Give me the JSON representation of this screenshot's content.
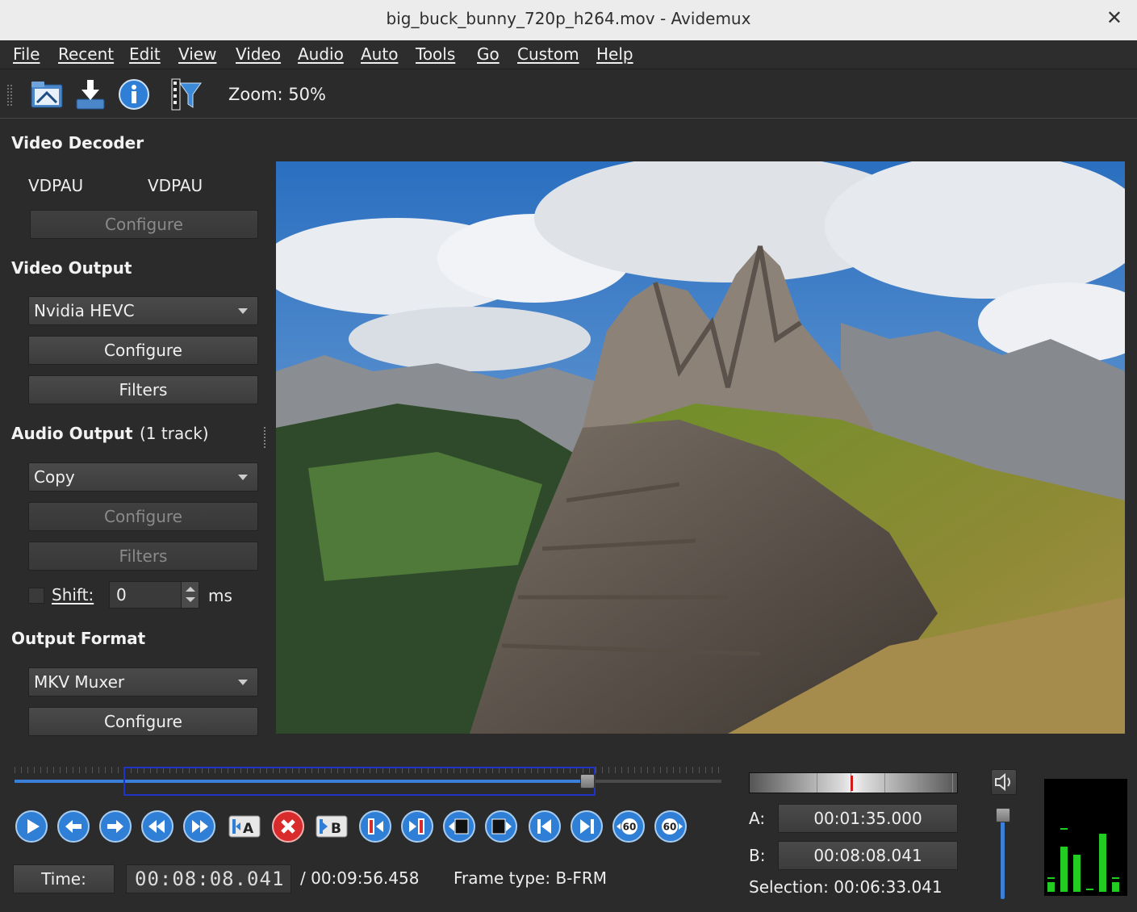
{
  "window": {
    "title": "big_buck_bunny_720p_h264.mov - Avidemux"
  },
  "menu": [
    "File",
    "Recent",
    "Edit",
    "View",
    "Video",
    "Audio",
    "Auto",
    "Tools",
    "Go",
    "Custom",
    "Help"
  ],
  "toolbar": {
    "icons": [
      "open-file-icon",
      "save-download-icon",
      "info-icon",
      "film-filter-icon"
    ],
    "zoom": "Zoom: 50%"
  },
  "video_decoder": {
    "title": "Video Decoder",
    "decoder_left": "VDPAU",
    "decoder_right": "VDPAU",
    "configure": "Configure"
  },
  "video_output": {
    "title": "Video Output",
    "codec": "Nvidia HEVC",
    "configure": "Configure",
    "filters": "Filters"
  },
  "audio_output": {
    "title": "Audio Output",
    "tracks": "(1 track)",
    "codec": "Copy",
    "configure": "Configure",
    "filters": "Filters",
    "shift_label": "Shift:",
    "shift_value": "0",
    "shift_unit": "ms"
  },
  "output_format": {
    "title": "Output Format",
    "muxer": "MKV Muxer",
    "configure": "Configure"
  },
  "timeline": {
    "position_fraction": 0.81
  },
  "controls": {
    "icons": [
      "play-icon",
      "previous-frame-icon",
      "next-frame-icon",
      "rewind-icon",
      "fast-forward-icon",
      "set-marker-a-icon",
      "delete-selection-icon",
      "set-marker-b-icon",
      "previous-cut-point-icon",
      "next-cut-point-icon",
      "previous-keyframe-icon",
      "next-keyframe-icon",
      "go-to-start-icon",
      "go-to-end-icon",
      "back-60s-icon",
      "forward-60s-icon"
    ],
    "sixty_label": "60"
  },
  "status": {
    "time_button": "Time:",
    "current_time": "00:08:08.041",
    "total_time": "/ 00:09:56.458",
    "frame_type": "Frame type:  B-FRM"
  },
  "markers": {
    "a_label": "A:",
    "a_value": "00:01:35.000",
    "b_label": "B:",
    "b_value": "00:08:08.041",
    "selection": "Selection: 00:06:33.041"
  },
  "colors": {
    "accent": "#3a7fd8",
    "selection_border": "#1f33c8",
    "jog_marker": "#d21a1a",
    "meter_green": "#22cc22"
  }
}
